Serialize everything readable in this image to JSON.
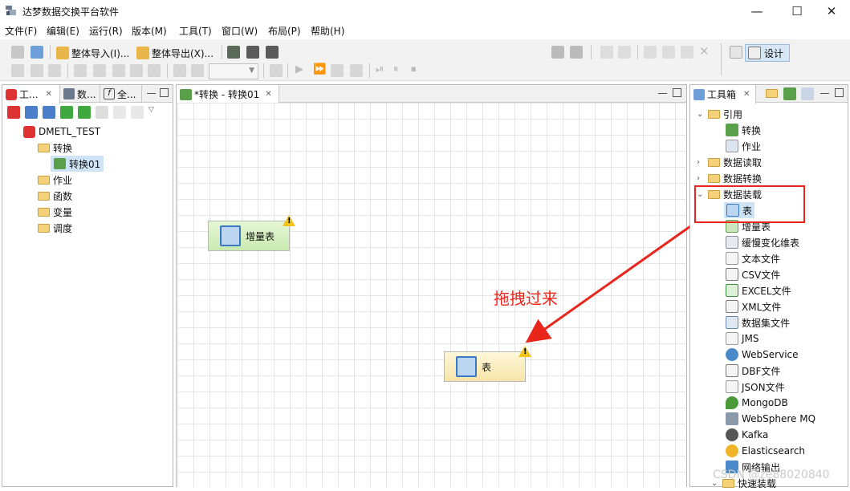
{
  "window": {
    "title": "达梦数据交换平台软件",
    "controls": [
      "—",
      "☐",
      "✕"
    ]
  },
  "menubar": [
    "文件(F)",
    "编辑(E)",
    "运行(R)",
    "版本(M)",
    "工具(T)",
    "窗口(W)",
    "布局(P)",
    "帮助(H)"
  ],
  "toolbar": {
    "export_all_import": "整体导入(I)...",
    "export_all_export": "整体导出(X)...",
    "design": "设计"
  },
  "left_panel": {
    "tabs": [
      "工...",
      "数...",
      "全..."
    ],
    "tree": {
      "root": "DMETL_TEST",
      "items": [
        {
          "label": "转换",
          "children": [
            "转换01"
          ]
        },
        {
          "label": "作业"
        },
        {
          "label": "函数"
        },
        {
          "label": "变量"
        },
        {
          "label": "调度"
        }
      ]
    }
  },
  "editor": {
    "tab": "*转换 - 转换01",
    "nodes": [
      {
        "label": "增量表",
        "color": "#d6f0bf"
      },
      {
        "label": "表",
        "color": "#fbefc0"
      }
    ],
    "annotation": "拖拽过来"
  },
  "toolbox": {
    "tab": "工具箱",
    "groups": [
      {
        "label": "引用",
        "expanded": true,
        "items": [
          "转换",
          "作业"
        ]
      },
      {
        "label": "数据读取",
        "expanded": false,
        "items": []
      },
      {
        "label": "数据转换",
        "expanded": false,
        "items": []
      },
      {
        "label": "数据装载",
        "expanded": true,
        "items": [
          "表",
          "增量表",
          "缓慢变化维表",
          "文本文件",
          "CSV文件",
          "EXCEL文件",
          "XML文件",
          "数据集文件",
          "JMS",
          "WebService",
          "DBF文件",
          "JSON文件",
          "MongoDB",
          "WebSphere MQ",
          "Kafka",
          "Elasticsearch",
          "网络输出"
        ]
      },
      {
        "label": "快速装载",
        "expanded": true,
        "items": []
      }
    ]
  },
  "watermark": "CSDN @ze88020840",
  "colors": {
    "accent_red": "#e8261c",
    "selection": "#cfe3f7",
    "folder": "#f5d27a"
  }
}
